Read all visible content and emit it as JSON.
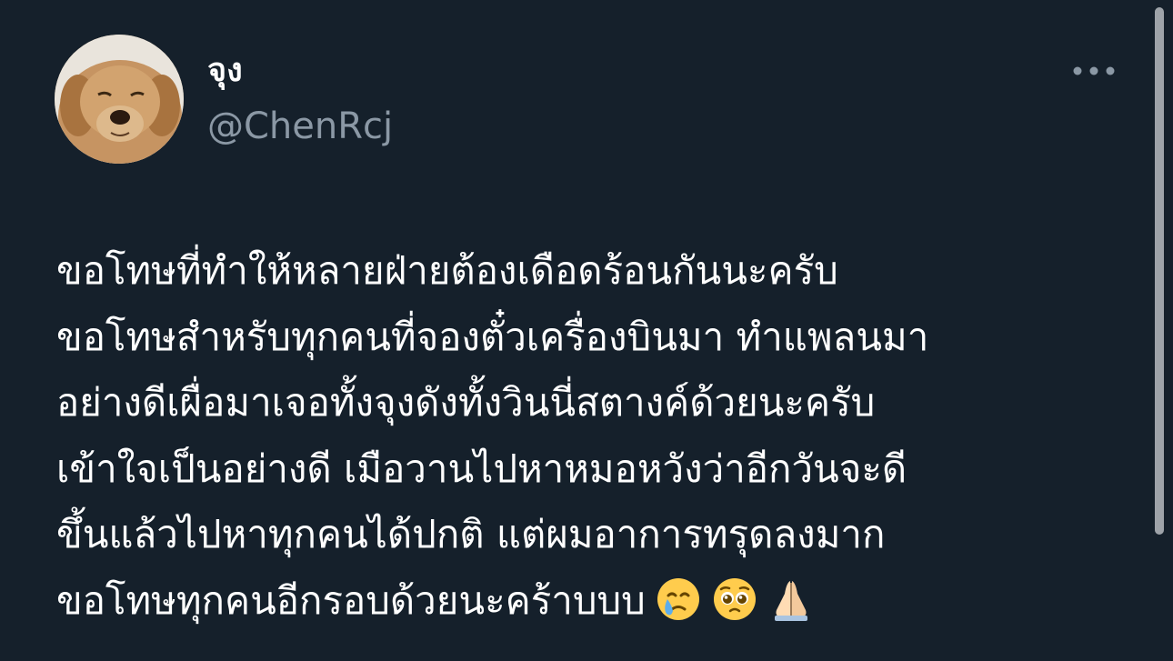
{
  "tweet": {
    "author": {
      "display_name": "จุง",
      "handle": "@ChenRcj",
      "avatar_icon": "dog-photo-avatar"
    },
    "more_icon": "more-horizontal-icon",
    "text_lines": [
      "ขอโทษที่ทำให้หลายฝ่ายต้องเดือดร้อนกันนะครับ",
      "ขอโทษสำหรับทุกคนที่จองตั๋วเครื่องบินมา ทำแพลนมา",
      "อย่างดีเผื่อมาเจอทั้งจุงดังทั้งวินนี่สตางค์ด้วยนะครับ",
      "เข้าใจเป็นอย่างดี เมือวานไปหาหมอหวังว่าอีกวันจะดี",
      "ขึ้นแล้วไปหาทุกคนได้ปกติ แต่ผมอาการทรุดลงมาก",
      "ขอโทษทุกคนอีกรอบด้วยนะคร้าบบบ"
    ],
    "emojis": [
      "crying-face-emoji",
      "pleading-face-emoji",
      "folded-hands-emoji"
    ]
  },
  "colors": {
    "background": "#15202b",
    "primary_text": "#ffffff",
    "secondary_text": "#8b98a5"
  }
}
